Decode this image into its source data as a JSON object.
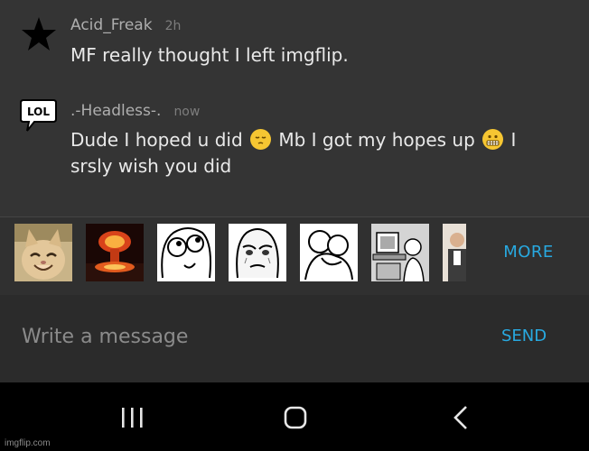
{
  "messages": [
    {
      "username": "Acid_Freak",
      "time": "2h",
      "avatar_icon": "star-icon",
      "text_parts": [
        "MF really thought I left imgflip."
      ]
    },
    {
      "username": ".-Headless-.",
      "time": "now",
      "avatar_icon": "lol-speech-bubble-icon",
      "text_parts": [
        "Dude I hoped u did ",
        " Mb I got my hopes up ",
        " I srsly wish you did"
      ],
      "emojis": [
        "pensive-face-emoji",
        "grimacing-face-emoji"
      ]
    }
  ],
  "meme_strip": {
    "thumbnails": [
      "smiling-cat-meme",
      "explosion-meme",
      "derp-face-meme",
      "okay-guy-meme",
      "hugging-wojak-meme",
      "computer-reaction-meme",
      "partial-meme"
    ],
    "more_label": "MORE"
  },
  "composer": {
    "placeholder": "Write a message",
    "send_label": "SEND"
  },
  "navbar": {
    "icons": [
      "recent-apps-icon",
      "home-icon",
      "back-icon"
    ]
  },
  "watermark": "imgflip.com",
  "colors": {
    "accent": "#28a9e0",
    "background": "#333333",
    "navbar": "#000000"
  }
}
